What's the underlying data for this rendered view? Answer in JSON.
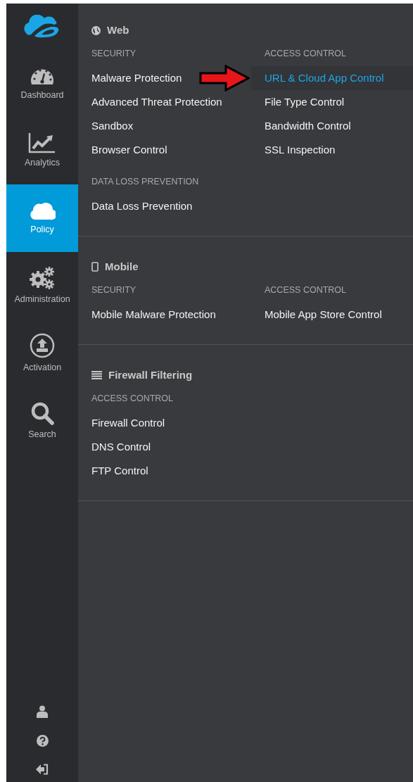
{
  "sidebar": {
    "items": [
      {
        "kind": "dashboard",
        "label": "Dashboard",
        "selected": false
      },
      {
        "kind": "analytics",
        "label": "Analytics",
        "selected": false
      },
      {
        "kind": "policy",
        "label": "Policy",
        "selected": true
      },
      {
        "kind": "administration",
        "label": "Administration",
        "selected": false
      },
      {
        "kind": "activation",
        "label": "Activation",
        "selected": false
      },
      {
        "kind": "search",
        "label": "Search",
        "selected": false
      }
    ],
    "bottom_icons": [
      {
        "kind": "user"
      },
      {
        "kind": "help"
      },
      {
        "kind": "logout"
      }
    ]
  },
  "menu": {
    "sections": [
      {
        "kind": "web",
        "title": "Web",
        "rows": [
          [
            {
              "heading": "SECURITY",
              "items": [
                {
                  "label": "Malware Protection",
                  "selected": false
                },
                {
                  "label": "Advanced Threat Protection",
                  "selected": false
                },
                {
                  "label": "Sandbox",
                  "selected": false
                },
                {
                  "label": "Browser Control",
                  "selected": false
                }
              ]
            },
            {
              "heading": "ACCESS CONTROL",
              "items": [
                {
                  "label": "URL & Cloud App Control",
                  "selected": true
                },
                {
                  "label": "File Type Control",
                  "selected": false
                },
                {
                  "label": "Bandwidth Control",
                  "selected": false
                },
                {
                  "label": "SSL Inspection",
                  "selected": false
                }
              ]
            }
          ],
          [
            {
              "heading": "DATA LOSS PREVENTION",
              "items": [
                {
                  "label": "Data Loss Prevention",
                  "selected": false
                }
              ]
            }
          ]
        ]
      },
      {
        "kind": "mobile",
        "title": "Mobile",
        "rows": [
          [
            {
              "heading": "SECURITY",
              "items": [
                {
                  "label": "Mobile Malware Protection",
                  "selected": false
                }
              ]
            },
            {
              "heading": "ACCESS CONTROL",
              "items": [
                {
                  "label": "Mobile App Store Control",
                  "selected": false
                }
              ]
            }
          ]
        ]
      },
      {
        "kind": "firewall",
        "title": "Firewall Filtering",
        "rows": [
          [
            {
              "heading": "ACCESS CONTROL",
              "items": [
                {
                  "label": "Firewall Control",
                  "selected": false
                },
                {
                  "label": "DNS Control",
                  "selected": false
                },
                {
                  "label": "FTP Control",
                  "selected": false
                }
              ]
            }
          ]
        ]
      }
    ],
    "pointer_arrow": true
  }
}
